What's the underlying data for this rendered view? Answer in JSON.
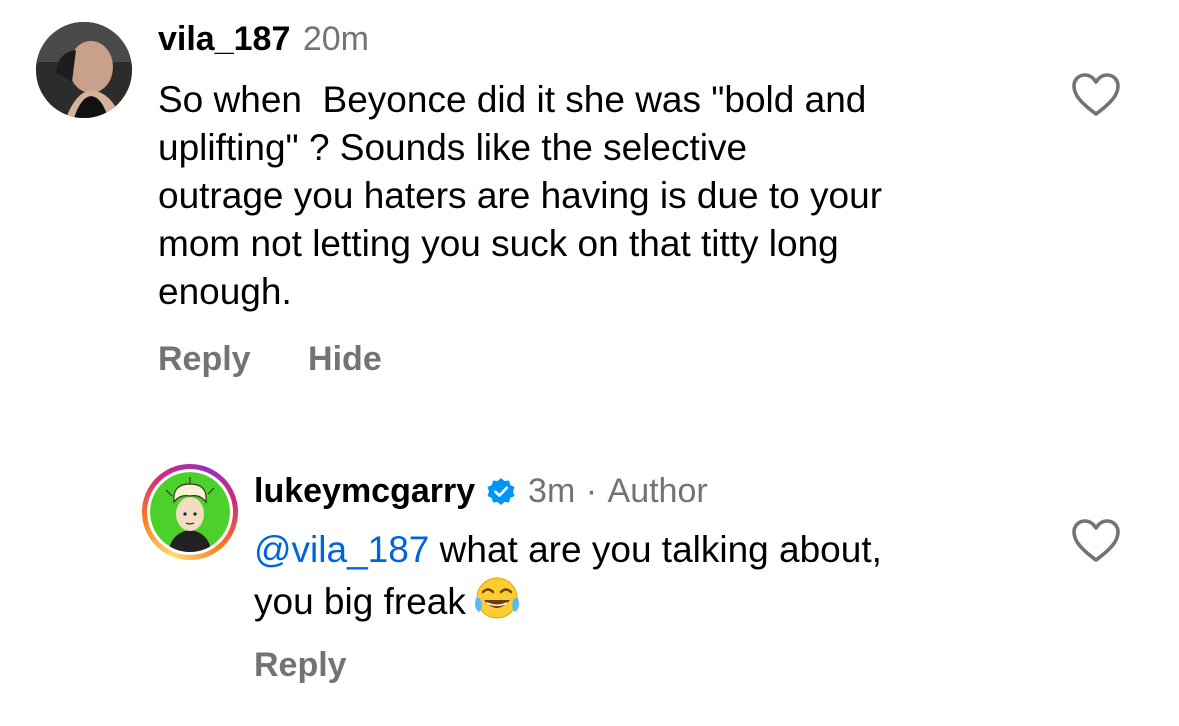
{
  "comments": [
    {
      "username": "vila_187",
      "time": "20m",
      "lines": [
        "So when  Beyonce did it she was \"bold and",
        "uplifting\" ? Sounds like the selective",
        "outrage you haters are having is due to your",
        "mom not letting you suck on that titty long",
        "enough."
      ],
      "reply_label": "Reply",
      "hide_label": "Hide"
    },
    {
      "username": "lukeymcgarry",
      "time": "3m",
      "separator": "·",
      "author_badge": "Author",
      "mention": "@vila_187",
      "line1_rest": " what are you talking about,",
      "line2": "you big freak",
      "emoji": "face-with-tears-of-joy",
      "reply_label": "Reply"
    }
  ],
  "colors": {
    "meta_gray": "#737373",
    "mention_blue": "#0064e0",
    "verified_blue": "#0095f6"
  }
}
